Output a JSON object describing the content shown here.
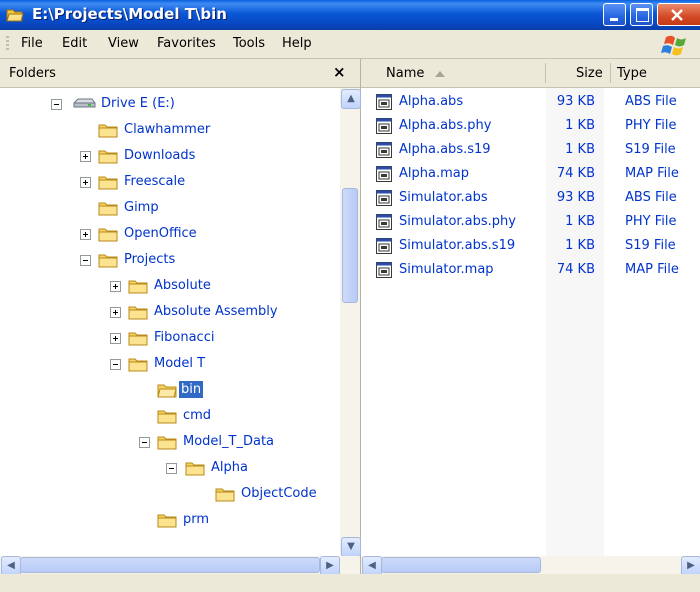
{
  "window": {
    "title": "E:\\Projects\\Model T\\bin"
  },
  "menu": {
    "items": [
      "File",
      "Edit",
      "View",
      "Favorites",
      "Tools",
      "Help"
    ]
  },
  "folders": {
    "title": "Folders",
    "close": "×",
    "tree": [
      {
        "label": "Drive E (E:)",
        "expander": "minus",
        "icon": "drive-icon"
      },
      {
        "label": "Clawhammer",
        "expander": "none",
        "icon": "folder-icon"
      },
      {
        "label": "Downloads",
        "expander": "plus",
        "icon": "folder-icon"
      },
      {
        "label": "Freescale",
        "expander": "plus",
        "icon": "folder-icon"
      },
      {
        "label": "Gimp",
        "expander": "none",
        "icon": "folder-icon"
      },
      {
        "label": "OpenOffice",
        "expander": "plus",
        "icon": "folder-icon"
      },
      {
        "label": "Projects",
        "expander": "minus",
        "icon": "folder-icon"
      },
      {
        "label": "Absolute",
        "expander": "plus",
        "icon": "folder-icon"
      },
      {
        "label": "Absolute Assembly",
        "expander": "plus",
        "icon": "folder-icon"
      },
      {
        "label": "Fibonacci",
        "expander": "plus",
        "icon": "folder-icon"
      },
      {
        "label": "Model T",
        "expander": "minus",
        "icon": "folder-icon"
      },
      {
        "label": "bin",
        "expander": "none",
        "icon": "open-folder-icon",
        "selected": true
      },
      {
        "label": "cmd",
        "expander": "none",
        "icon": "folder-icon"
      },
      {
        "label": "Model_T_Data",
        "expander": "minus",
        "icon": "folder-icon"
      },
      {
        "label": "Alpha",
        "expander": "minus",
        "icon": "folder-icon"
      },
      {
        "label": "ObjectCode",
        "expander": "none",
        "icon": "folder-icon"
      },
      {
        "label": "prm",
        "expander": "none",
        "icon": "folder-icon"
      }
    ]
  },
  "list": {
    "columns": {
      "name": "Name",
      "size": "Size",
      "type": "Type"
    },
    "files": [
      {
        "name": "Alpha.abs",
        "size": "93 KB",
        "type": "ABS File"
      },
      {
        "name": "Alpha.abs.phy",
        "size": "1 KB",
        "type": "PHY File"
      },
      {
        "name": "Alpha.abs.s19",
        "size": "1 KB",
        "type": "S19 File"
      },
      {
        "name": "Alpha.map",
        "size": "74 KB",
        "type": "MAP File"
      },
      {
        "name": "Simulator.abs",
        "size": "93 KB",
        "type": "ABS File"
      },
      {
        "name": "Simulator.abs.phy",
        "size": "1 KB",
        "type": "PHY File"
      },
      {
        "name": "Simulator.abs.s19",
        "size": "1 KB",
        "type": "S19 File"
      },
      {
        "name": "Simulator.map",
        "size": "74 KB",
        "type": "MAP File"
      }
    ]
  },
  "colors": {
    "title_bar": "#0a57d6",
    "selection": "#316ac5",
    "link_text": "#0033cc",
    "close_button": "#d44a25"
  }
}
